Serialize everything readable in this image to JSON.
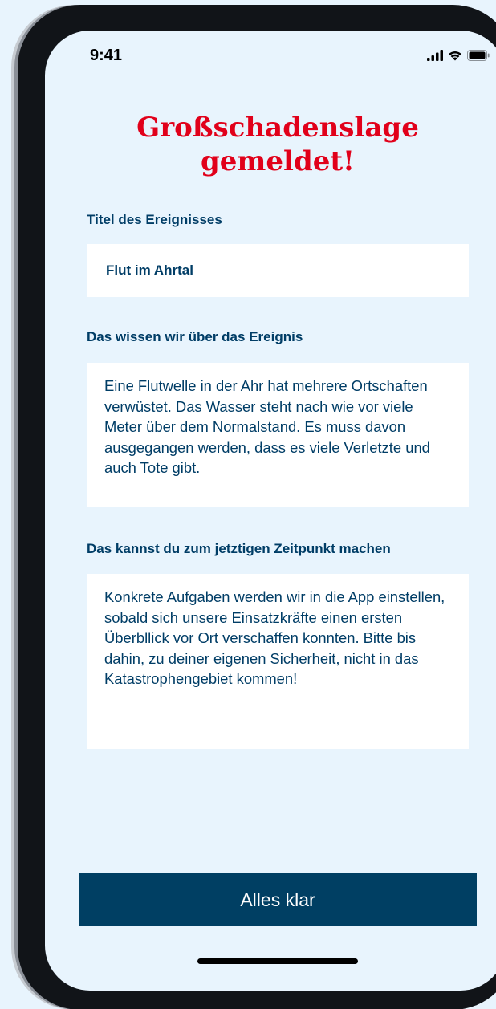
{
  "status_bar": {
    "time": "9:41",
    "icons": [
      "cellular-signal-icon",
      "wifi-icon",
      "battery-icon"
    ]
  },
  "title": {
    "line1": "Großschadenslage",
    "line2": "gemeldet!"
  },
  "event_title": {
    "label": "Titel des Ereignisses",
    "value": "Flut im Ahrtal"
  },
  "event_info": {
    "label": "Das wissen wir über das Ereignis",
    "text": "Eine Flutwelle in der Ahr hat mehrere Ortschaften verwüstet. Das Wasser steht nach wie vor viele Meter über dem Normalstand. Es muss davon ausgegangen werden, dass es viele Verletzte und auch Tote gibt."
  },
  "actions": {
    "label": "Das kannst du zum jetztigen Zeitpunkt machen",
    "text": "Konkrete Aufgaben werden wir in die App einstellen, sobald sich unsere Einsatzkräfte einen ersten Überbllick vor Ort verschaffen konnten. Bitte bis dahin, zu deiner eigenen Sicherheit, nicht in das Katastrophengebiet kommen!"
  },
  "confirm_button": {
    "label": "Alles klar"
  },
  "colors": {
    "title_red": "#e1001a",
    "navy": "#003d66",
    "button": "#003f63",
    "screen_bg": "#e8f4fd"
  }
}
